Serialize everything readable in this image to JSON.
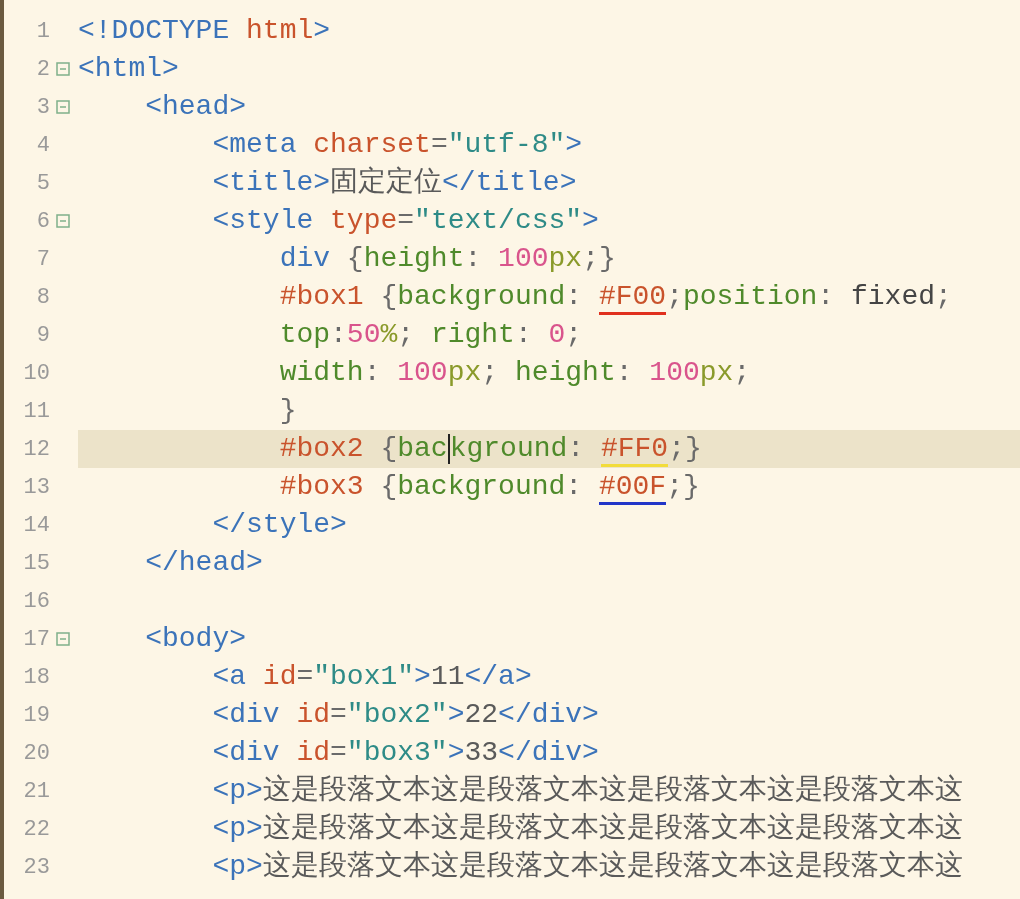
{
  "lines": [
    {
      "number": "1",
      "foldable": false,
      "current": false,
      "tokens": [
        {
          "kind": "tag",
          "text": "<!DOCTYPE "
        },
        {
          "kind": "attr",
          "text": "html"
        },
        {
          "kind": "tag",
          "text": ">"
        }
      ]
    },
    {
      "number": "2",
      "foldable": true,
      "current": false,
      "tokens": [
        {
          "kind": "tag",
          "text": "<html>"
        }
      ]
    },
    {
      "number": "3",
      "foldable": true,
      "current": false,
      "tokens": [
        {
          "kind": "tag",
          "text": "    <head>"
        }
      ]
    },
    {
      "number": "4",
      "foldable": false,
      "current": false,
      "tokens": [
        {
          "kind": "tag",
          "text": "        <meta "
        },
        {
          "kind": "attr",
          "text": "charset"
        },
        {
          "kind": "punct",
          "text": "="
        },
        {
          "kind": "string",
          "text": "\"utf-8\""
        },
        {
          "kind": "tag",
          "text": ">"
        }
      ]
    },
    {
      "number": "5",
      "foldable": false,
      "current": false,
      "tokens": [
        {
          "kind": "tag",
          "text": "        <title>"
        },
        {
          "kind": "text",
          "text": "固定定位"
        },
        {
          "kind": "tag",
          "text": "</title>"
        }
      ]
    },
    {
      "number": "6",
      "foldable": true,
      "current": false,
      "tokens": [
        {
          "kind": "tag",
          "text": "        <style "
        },
        {
          "kind": "attr",
          "text": "type"
        },
        {
          "kind": "punct",
          "text": "="
        },
        {
          "kind": "string",
          "text": "\"text/css\""
        },
        {
          "kind": "tag",
          "text": ">"
        }
      ]
    },
    {
      "number": "7",
      "foldable": false,
      "current": false,
      "tokens": [
        {
          "kind": "tag",
          "text": "            div "
        },
        {
          "kind": "punct",
          "text": "{"
        },
        {
          "kind": "property",
          "text": "height"
        },
        {
          "kind": "punct",
          "text": ": "
        },
        {
          "kind": "number",
          "text": "100"
        },
        {
          "kind": "unit",
          "text": "px"
        },
        {
          "kind": "punct",
          "text": ";}"
        }
      ]
    },
    {
      "number": "8",
      "foldable": false,
      "current": false,
      "tokens": [
        {
          "kind": "selector",
          "text": "            #box1"
        },
        {
          "kind": "punct",
          "text": " {"
        },
        {
          "kind": "property",
          "text": "background"
        },
        {
          "kind": "punct",
          "text": ": "
        },
        {
          "kind": "selector",
          "text": "#F00",
          "color": "#e0301e"
        },
        {
          "kind": "punct",
          "text": ";"
        },
        {
          "kind": "property",
          "text": "position"
        },
        {
          "kind": "punct",
          "text": ": "
        },
        {
          "kind": "keyword",
          "text": "fixed"
        },
        {
          "kind": "punct",
          "text": ";"
        }
      ]
    },
    {
      "number": "9",
      "foldable": false,
      "current": false,
      "tokens": [
        {
          "kind": "property",
          "text": "            top"
        },
        {
          "kind": "punct",
          "text": ":"
        },
        {
          "kind": "number",
          "text": "50"
        },
        {
          "kind": "unit",
          "text": "%"
        },
        {
          "kind": "punct",
          "text": "; "
        },
        {
          "kind": "property",
          "text": "right"
        },
        {
          "kind": "punct",
          "text": ": "
        },
        {
          "kind": "number",
          "text": "0"
        },
        {
          "kind": "punct",
          "text": ";"
        }
      ]
    },
    {
      "number": "10",
      "foldable": false,
      "current": false,
      "tokens": [
        {
          "kind": "property",
          "text": "            width"
        },
        {
          "kind": "punct",
          "text": ": "
        },
        {
          "kind": "number",
          "text": "100"
        },
        {
          "kind": "unit",
          "text": "px"
        },
        {
          "kind": "punct",
          "text": "; "
        },
        {
          "kind": "property",
          "text": "height"
        },
        {
          "kind": "punct",
          "text": ": "
        },
        {
          "kind": "number",
          "text": "100"
        },
        {
          "kind": "unit",
          "text": "px"
        },
        {
          "kind": "punct",
          "text": ";"
        }
      ]
    },
    {
      "number": "11",
      "foldable": false,
      "current": false,
      "tokens": [
        {
          "kind": "punct",
          "text": "            }"
        }
      ]
    },
    {
      "number": "12",
      "foldable": false,
      "current": true,
      "tokens": [
        {
          "kind": "selector",
          "text": "            #box2"
        },
        {
          "kind": "punct",
          "text": " {"
        },
        {
          "kind": "property",
          "text": "bac"
        },
        {
          "kind": "cursor"
        },
        {
          "kind": "property",
          "text": "kground"
        },
        {
          "kind": "punct",
          "text": ": "
        },
        {
          "kind": "selector",
          "text": "#FF0",
          "color": "#f2dc3a"
        },
        {
          "kind": "punct",
          "text": ";}"
        }
      ]
    },
    {
      "number": "13",
      "foldable": false,
      "current": false,
      "tokens": [
        {
          "kind": "selector",
          "text": "            #box3"
        },
        {
          "kind": "punct",
          "text": " {"
        },
        {
          "kind": "property",
          "text": "background"
        },
        {
          "kind": "punct",
          "text": ": "
        },
        {
          "kind": "selector",
          "text": "#00F",
          "color": "#2236c8"
        },
        {
          "kind": "punct",
          "text": ";}"
        }
      ]
    },
    {
      "number": "14",
      "foldable": false,
      "current": false,
      "tokens": [
        {
          "kind": "tag",
          "text": "        </style>"
        }
      ]
    },
    {
      "number": "15",
      "foldable": false,
      "current": false,
      "tokens": [
        {
          "kind": "tag",
          "text": "    </head>"
        }
      ]
    },
    {
      "number": "16",
      "foldable": false,
      "current": false
    },
    {
      "number": "17",
      "foldable": true,
      "current": false,
      "tokens": [
        {
          "kind": "tag",
          "text": "    <body>"
        }
      ]
    },
    {
      "number": "18",
      "foldable": false,
      "current": false,
      "tokens": [
        {
          "kind": "tag",
          "text": "        <a "
        },
        {
          "kind": "attr",
          "text": "id"
        },
        {
          "kind": "punct",
          "text": "="
        },
        {
          "kind": "string",
          "text": "\"box1\""
        },
        {
          "kind": "tag",
          "text": ">"
        },
        {
          "kind": "text",
          "text": "11"
        },
        {
          "kind": "tag",
          "text": "</a>"
        }
      ]
    },
    {
      "number": "19",
      "foldable": false,
      "current": false,
      "tokens": [
        {
          "kind": "tag",
          "text": "        <div "
        },
        {
          "kind": "attr",
          "text": "id"
        },
        {
          "kind": "punct",
          "text": "="
        },
        {
          "kind": "string",
          "text": "\"box2\""
        },
        {
          "kind": "tag",
          "text": ">"
        },
        {
          "kind": "text",
          "text": "22"
        },
        {
          "kind": "tag",
          "text": "</div>"
        }
      ]
    },
    {
      "number": "20",
      "foldable": false,
      "current": false,
      "tokens": [
        {
          "kind": "tag",
          "text": "        <div "
        },
        {
          "kind": "attr",
          "text": "id"
        },
        {
          "kind": "punct",
          "text": "="
        },
        {
          "kind": "string",
          "text": "\"box3\""
        },
        {
          "kind": "tag",
          "text": ">"
        },
        {
          "kind": "text",
          "text": "33"
        },
        {
          "kind": "tag",
          "text": "</div>"
        }
      ]
    },
    {
      "number": "21",
      "foldable": false,
      "current": false,
      "tokens": [
        {
          "kind": "tag",
          "text": "        <p>"
        },
        {
          "kind": "text",
          "text": "这是段落文本这是段落文本这是段落文本这是段落文本这"
        }
      ]
    },
    {
      "number": "22",
      "foldable": false,
      "current": false,
      "tokens": [
        {
          "kind": "tag",
          "text": "        <p>"
        },
        {
          "kind": "text",
          "text": "这是段落文本这是段落文本这是段落文本这是段落文本这"
        }
      ]
    },
    {
      "number": "23",
      "foldable": false,
      "current": false,
      "tokens": [
        {
          "kind": "tag",
          "text": "        <p>"
        },
        {
          "kind": "text",
          "text": "这是段落文本这是段落文本这是段落文本这是段落文本这"
        }
      ]
    }
  ]
}
